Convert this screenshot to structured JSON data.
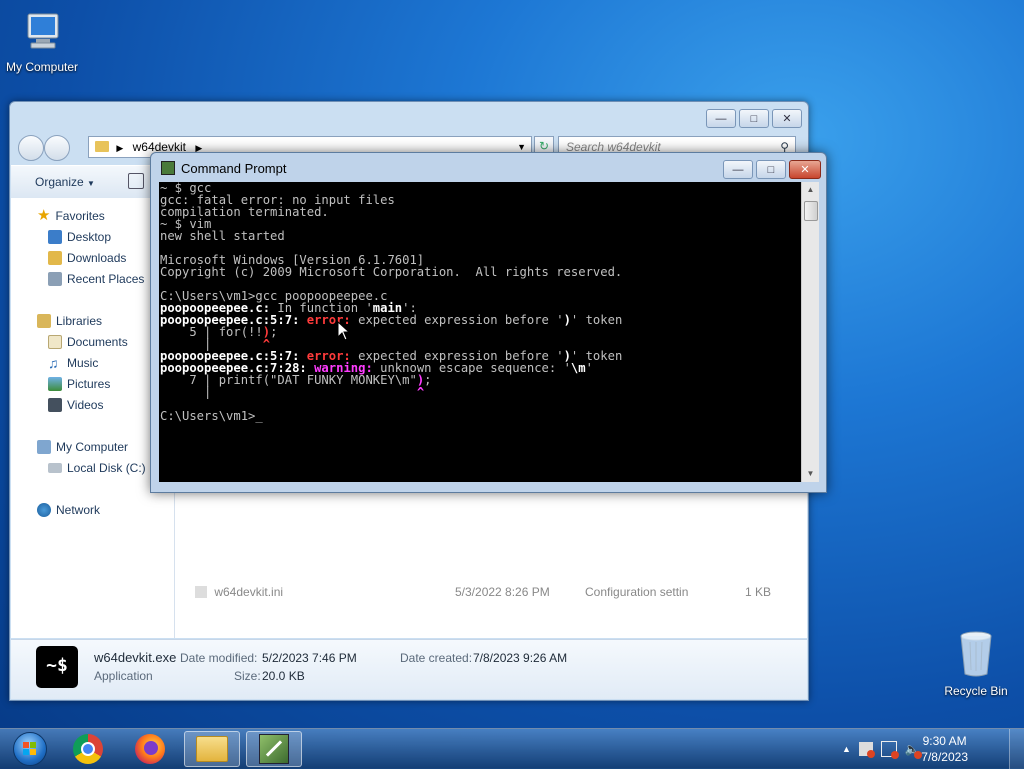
{
  "desktop": {
    "my_computer_label": "My Computer",
    "recycle_bin_label": "Recycle Bin"
  },
  "explorer": {
    "address_path": "w64devkit",
    "search_placeholder": "Search w64devkit",
    "toolbar": {
      "organize_label": "Organize"
    },
    "sidebar": {
      "favorites": "Favorites",
      "desktop": "Desktop",
      "downloads": "Downloads",
      "recent_places": "Recent Places",
      "libraries": "Libraries",
      "documents": "Documents",
      "music": "Music",
      "pictures": "Pictures",
      "videos": "Videos",
      "my_computer": "My Computer",
      "local_disk": "Local Disk (C:)",
      "network": "Network"
    },
    "file_row": {
      "name": "w64devkit.ini",
      "date": "5/3/2022 8:26 PM",
      "type": "Configuration settin",
      "size": "1 KB"
    },
    "details": {
      "file_name": "w64devkit.exe",
      "file_type": "Application",
      "date_modified_label": "Date modified:",
      "date_modified": "5/2/2023 7:46 PM",
      "size_label": "Size:",
      "size": "20.0 KB",
      "date_created_label": "Date created:",
      "date_created": "7/8/2023 9:26 AM"
    }
  },
  "cmd": {
    "title": "Command Prompt",
    "lines": {
      "l1": "~ $ gcc",
      "l2": "gcc: fatal error: no input files",
      "l3": "compilation terminated.",
      "l4": "~ $ vim",
      "l5": "new shell started",
      "l6": "Microsoft Windows [Version 6.1.7601]",
      "l7": "Copyright (c) 2009 Microsoft Corporation.  All rights reserved.",
      "l8": "C:\\Users\\vm1>gcc poopoopeepee.c",
      "l9_a": "poopoopeepee.c:",
      "l9_b": " In function '",
      "l9_c": "main",
      "l9_d": "':",
      "l10_a": "poopoopeepee.c:5:7: ",
      "l10_err": "error:",
      "l10_msg": " expected expression before '",
      "l10_tok": ")",
      "l10_end": "' token",
      "l11_a": "    5 | for(!!",
      "l11_hl": ")",
      "l11_b": ";",
      "l12_a": "      |       ",
      "l12_caret": "^",
      "l13_a": "poopoopeepee.c:5:7: ",
      "l13_err": "error:",
      "l13_msg": " expected expression before '",
      "l13_tok": ")",
      "l13_end": "' token",
      "l14_a": "poopoopeepee.c:7:28: ",
      "l14_warn": "warning:",
      "l14_msg": " unknown escape sequence: '",
      "l14_tok": "\\m",
      "l14_end": "'",
      "l15_a": "    7 | printf(\"DAT FUNKY MONKEY\\m\"",
      "l15_hl": ")",
      "l15_b": ";",
      "l16_a": "      |                            ",
      "l16_caret": "^",
      "l17": "C:\\Users\\vm1>",
      "cursor": "_"
    }
  },
  "taskbar": {
    "time": "9:30 AM",
    "date": "7/8/2023"
  },
  "icons": {
    "start": "windows-orb-icon",
    "chrome": "chrome-icon",
    "firefox": "firefox-icon",
    "explorer": "folder-icon",
    "w64devkit": "w64devkit-icon"
  },
  "colors": {
    "error": "#ff3b3b",
    "warning": "#ff3cff",
    "console_bg": "#000000",
    "console_fg": "#c0c0c0"
  }
}
